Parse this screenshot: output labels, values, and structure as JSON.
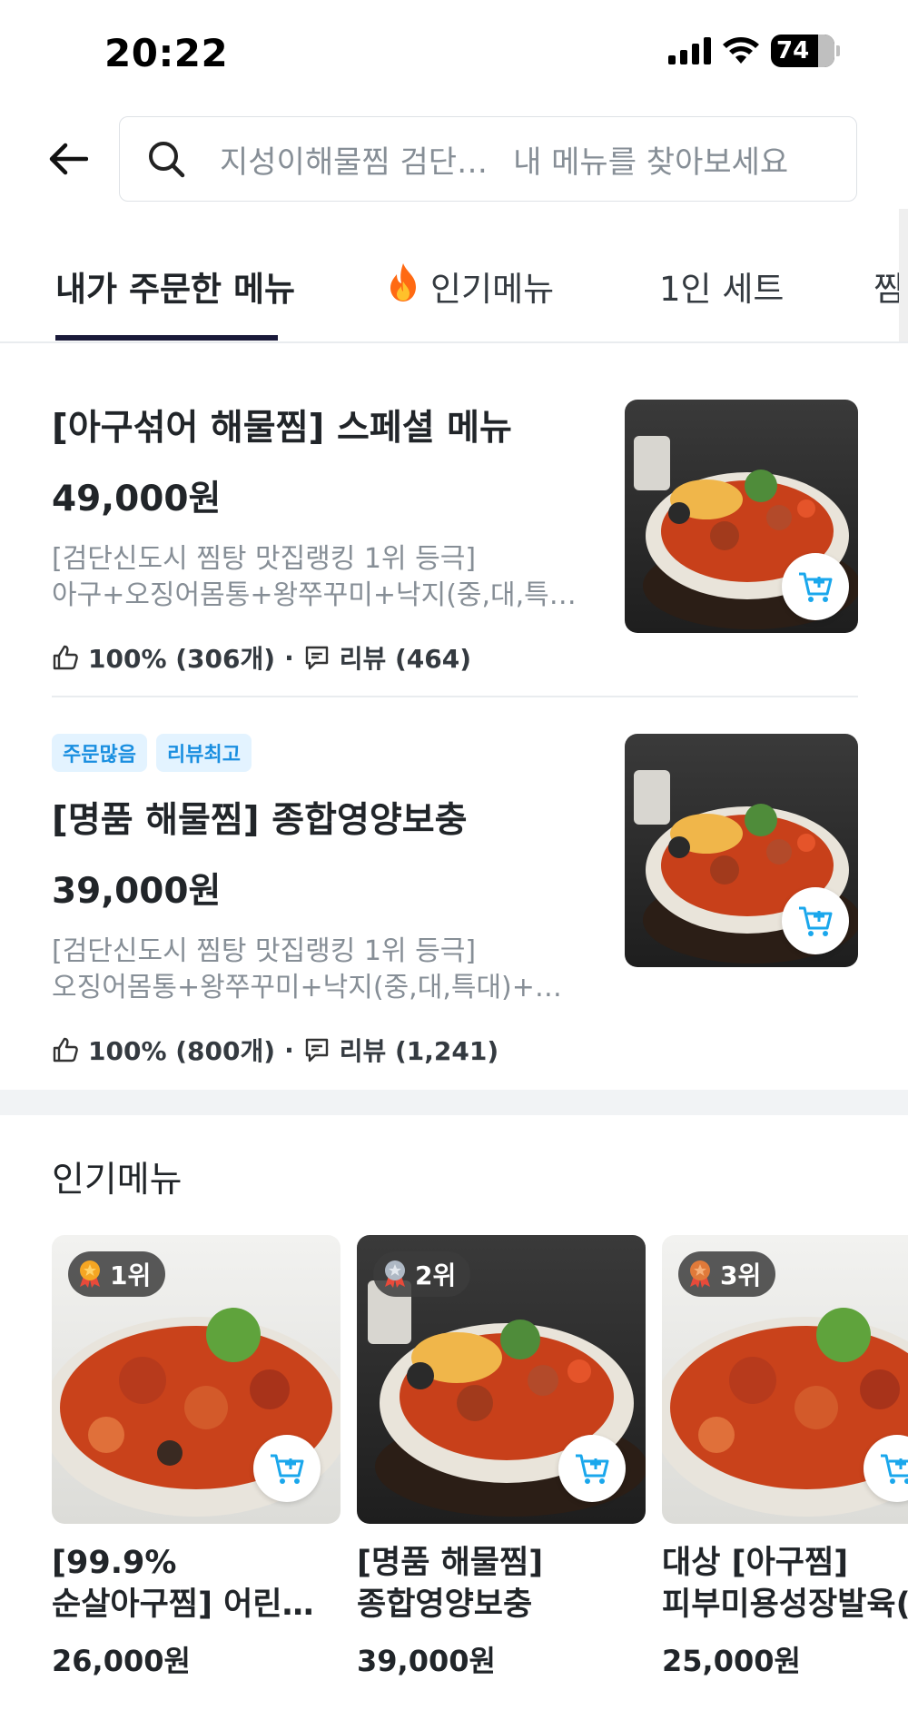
{
  "status_bar": {
    "time": "20:22",
    "battery": "74"
  },
  "search": {
    "store_name": "지성이해물찜 검단…",
    "placeholder": "내 메뉴를 찾아보세요"
  },
  "tabs": [
    {
      "label": "내가 주문한 메뉴"
    },
    {
      "label": "인기메뉴"
    },
    {
      "label": "1인 세트"
    },
    {
      "label": "찜"
    }
  ],
  "menu_items": [
    {
      "title": "[아구섞어 해물찜] 스페셜 메뉴",
      "price": "49,000원",
      "desc_line1": "[검단신도시 찜탕 맛집랭킹 1위 등극]",
      "desc_line2": "아구+오징어몸통+왕쭈꾸미+낙지(중,대,특…",
      "likes": "100% (306개)",
      "reviews": "리뷰 (464)"
    },
    {
      "badges": [
        "주문많음",
        "리뷰최고"
      ],
      "title": "[명품 해물찜] 종합영양보충",
      "price": "39,000원",
      "desc_line1": "[검단신도시 찜탕 맛집랭킹 1위 등극]",
      "desc_line2": "오징어몸통+왕쭈꾸미+낙지(중,대,특대)+…",
      "likes": "100% (800개)",
      "reviews": "리뷰 (1,241)"
    }
  ],
  "popular": {
    "title": "인기메뉴",
    "cards": [
      {
        "rank": "1위",
        "name_line1": "[99.9%",
        "name_line2": "순살아구찜] 어린…",
        "price": "26,000원"
      },
      {
        "rank": "2위",
        "name_line1": "[명품 해물찜]",
        "name_line2": "종합영양보충",
        "price": "39,000원"
      },
      {
        "rank": "3위",
        "name_line1": "대상 [아구찜]",
        "name_line2": "피부미용성장발육(",
        "price": "25,000원"
      }
    ]
  },
  "colors": {
    "accent_underline": "#1a1a3a",
    "badge_text": "#1a8fe0",
    "badge_bg": "#e3f3ff",
    "cart_icon": "#1aa7ec"
  },
  "icons": [
    "back-arrow-icon",
    "search-icon",
    "fire-icon",
    "thumbs-up-icon",
    "review-icon",
    "add-to-cart-icon",
    "medal-icon"
  ]
}
